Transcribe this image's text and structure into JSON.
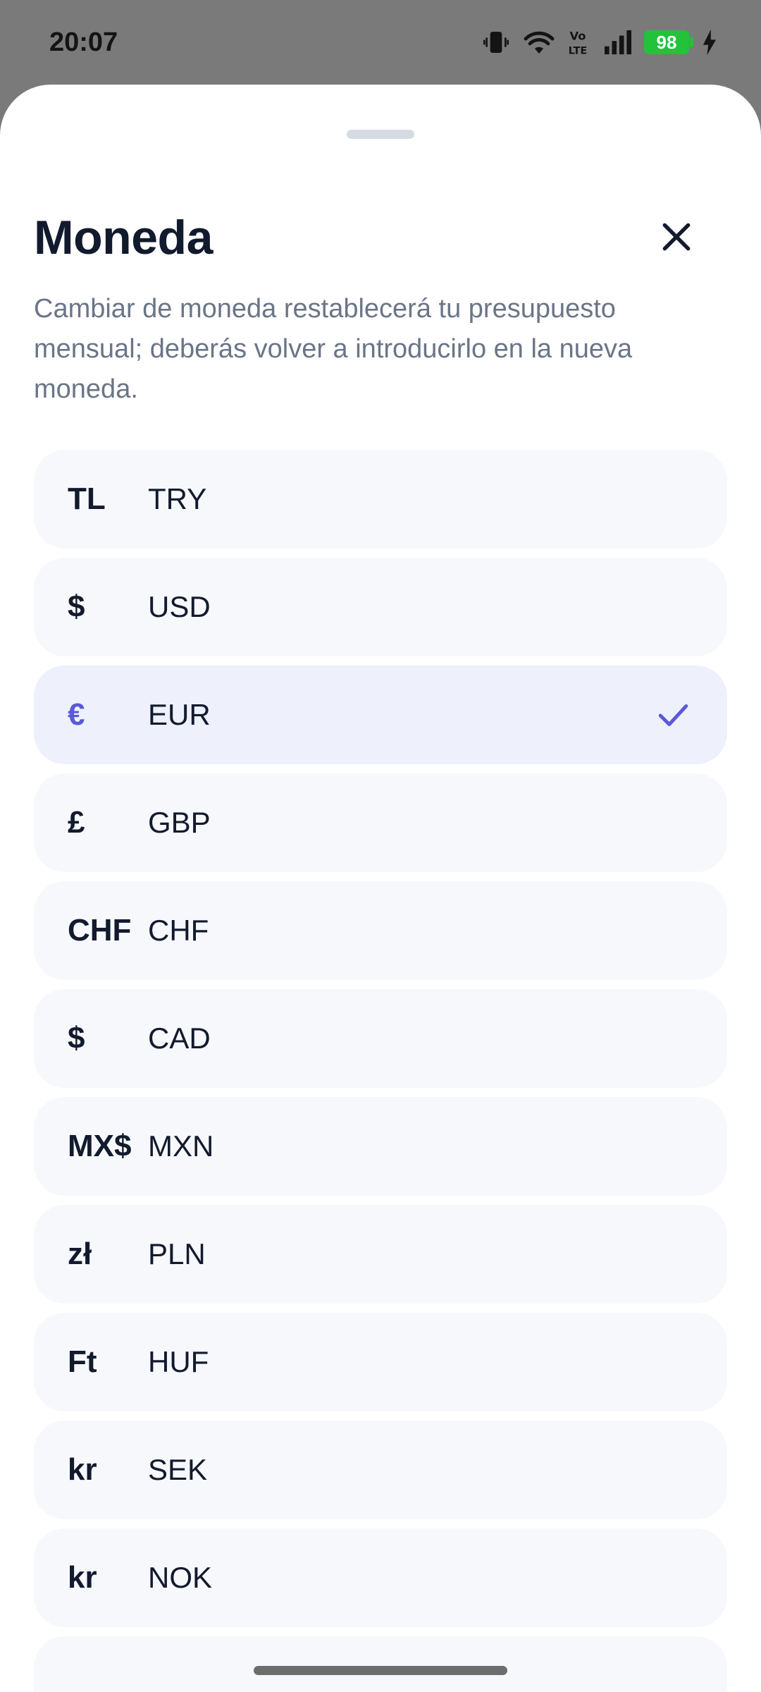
{
  "status_bar": {
    "time": "20:07",
    "battery_level": "98",
    "battery_color": "#22c23a",
    "icons": [
      "vibrate-icon",
      "wifi-icon",
      "volte-icon",
      "signal-icon",
      "battery-icon",
      "charging-icon"
    ]
  },
  "sheet": {
    "title": "Moneda",
    "description": "Cambiar de moneda restablecerá tu presupuesto mensual; deberás volver a introducirlo en la nueva moneda.",
    "accent_color": "#5b58d9",
    "currencies": [
      {
        "symbol": "TL",
        "code": "TRY",
        "selected": false
      },
      {
        "symbol": "$",
        "code": "USD",
        "selected": false
      },
      {
        "symbol": "€",
        "code": "EUR",
        "selected": true
      },
      {
        "symbol": "£",
        "code": "GBP",
        "selected": false
      },
      {
        "symbol": "CHF",
        "code": "CHF",
        "selected": false
      },
      {
        "symbol": "$",
        "code": "CAD",
        "selected": false
      },
      {
        "symbol": "MX$",
        "code": "MXN",
        "selected": false
      },
      {
        "symbol": "zł",
        "code": "PLN",
        "selected": false
      },
      {
        "symbol": "Ft",
        "code": "HUF",
        "selected": false
      },
      {
        "symbol": "kr",
        "code": "SEK",
        "selected": false
      },
      {
        "symbol": "kr",
        "code": "NOK",
        "selected": false
      }
    ]
  }
}
